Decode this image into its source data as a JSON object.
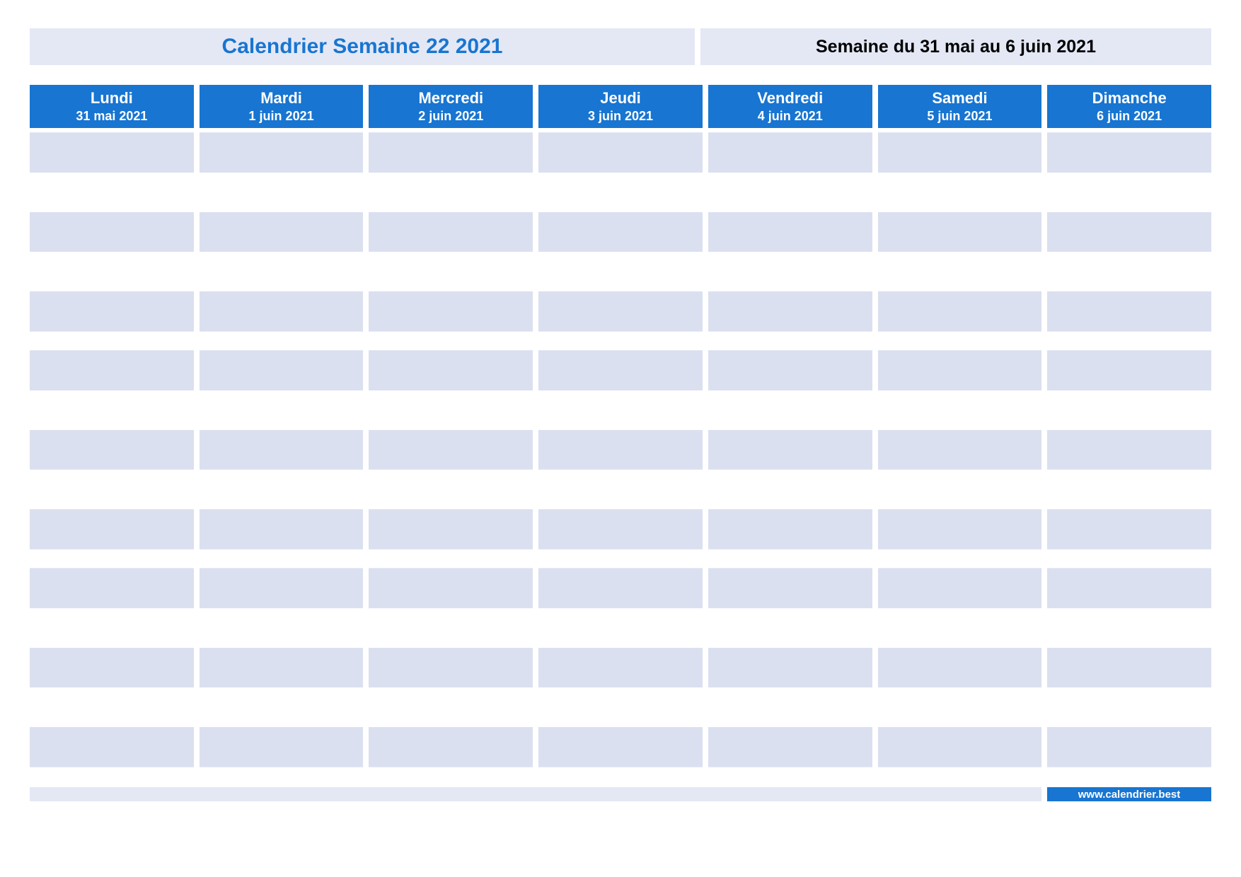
{
  "header": {
    "title": "Calendrier Semaine 22 2021",
    "subtitle": "Semaine du 31 mai au 6 juin 2021"
  },
  "days": [
    {
      "name": "Lundi",
      "date": "31 mai 2021"
    },
    {
      "name": "Mardi",
      "date": "1 juin 2021"
    },
    {
      "name": "Mercredi",
      "date": "2 juin 2021"
    },
    {
      "name": "Jeudi",
      "date": "3 juin 2021"
    },
    {
      "name": "Vendredi",
      "date": "4 juin 2021"
    },
    {
      "name": "Samedi",
      "date": "5 juin 2021"
    },
    {
      "name": "Dimanche",
      "date": "6 juin 2021"
    }
  ],
  "footer": {
    "site": "www.calendrier.best"
  },
  "colors": {
    "brand_blue": "#1875d1",
    "pale_blue": "#e4e8f5",
    "slot_shade": "#dbe0f0"
  },
  "layout": {
    "time_blocks": 3,
    "slots_per_block": 5
  }
}
